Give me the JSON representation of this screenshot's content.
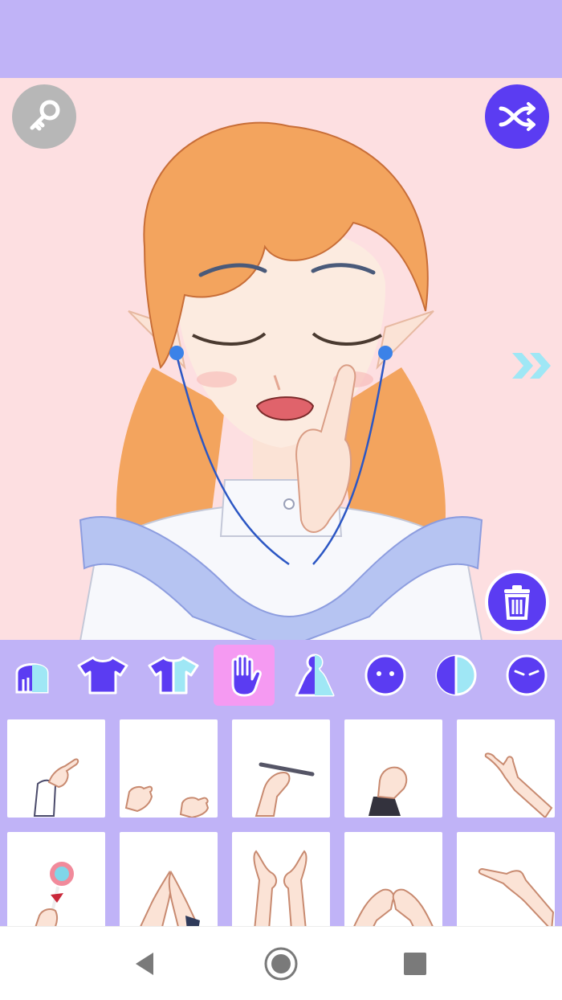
{
  "colors": {
    "accent": "#5b3cf2",
    "lavender": "#c0b3f7",
    "stage_pink": "#fddfe1",
    "active_tab": "#f59af2",
    "icon_light": "#9fe7f5"
  },
  "stage": {
    "key_icon": "key-icon",
    "shuffle_icon": "shuffle-icon",
    "trash_icon": "trash-icon",
    "next_icon": "double-chevron-right-icon"
  },
  "categories": [
    {
      "id": "hair-back",
      "icon": "hair-back-icon",
      "active": false
    },
    {
      "id": "top-shirt",
      "icon": "shirt-icon",
      "active": false
    },
    {
      "id": "shirt-color",
      "icon": "shirt-two-tone-icon",
      "active": false
    },
    {
      "id": "hands",
      "icon": "hand-icon",
      "active": true
    },
    {
      "id": "body",
      "icon": "body-silhouette-icon",
      "active": false
    },
    {
      "id": "face",
      "icon": "face-icon",
      "active": false
    },
    {
      "id": "skin-tone",
      "icon": "half-circle-icon",
      "active": false
    },
    {
      "id": "eyes",
      "icon": "eyes-face-icon",
      "active": false
    }
  ],
  "hand_options": [
    "pointing-hand-sleeve",
    "claw-hands",
    "hand-holding-pen",
    "fist-dark-sleeve",
    "raised-hand",
    "hand-holding-lollipop",
    "praying-hands",
    "open-palms",
    "heart-hands",
    "pointing-finger-side"
  ]
}
